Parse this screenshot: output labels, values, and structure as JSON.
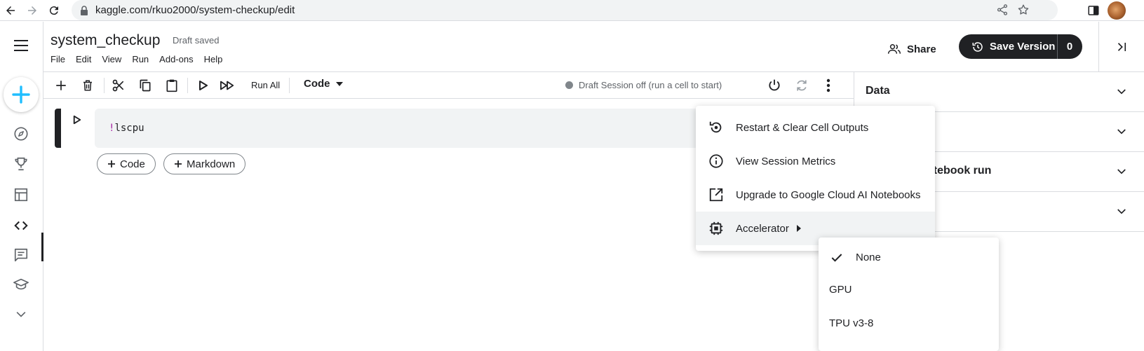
{
  "browser": {
    "url": "kaggle.com/rkuo2000/system-checkup/edit"
  },
  "header": {
    "title": "system_checkup",
    "status": "Draft saved",
    "menu": [
      "File",
      "Edit",
      "View",
      "Run",
      "Add-ons",
      "Help"
    ],
    "share_label": "Share",
    "save_version_label": "Save Version",
    "save_version_count": "0"
  },
  "toolbar": {
    "run_all_label": "Run All",
    "cell_type": "Code",
    "session_status": "Draft Session off (run a cell to start)"
  },
  "cell": {
    "code_bang": "!",
    "code_rest": "lscpu"
  },
  "add_cell": {
    "code_label": "Code",
    "markdown_label": "Markdown"
  },
  "right_panel": {
    "sections": [
      "Data",
      "",
      "otebook run",
      ""
    ]
  },
  "dropdown": {
    "items": [
      {
        "label": "Restart & Clear Cell Outputs",
        "icon": "restart-icon"
      },
      {
        "label": "View Session Metrics",
        "icon": "info-icon"
      },
      {
        "label": "Upgrade to Google Cloud AI Notebooks",
        "icon": "open-in-new-icon"
      },
      {
        "label": "Accelerator",
        "icon": "chip-icon"
      }
    ]
  },
  "accelerator_submenu": {
    "items": [
      {
        "label": "None",
        "selected": true
      },
      {
        "label": "GPU",
        "selected": false
      },
      {
        "label": "TPU v3-8",
        "selected": false
      }
    ]
  },
  "colors": {
    "accent": "#20beff",
    "dark": "#202124",
    "muted": "#5f6368",
    "border": "#dadce0"
  }
}
